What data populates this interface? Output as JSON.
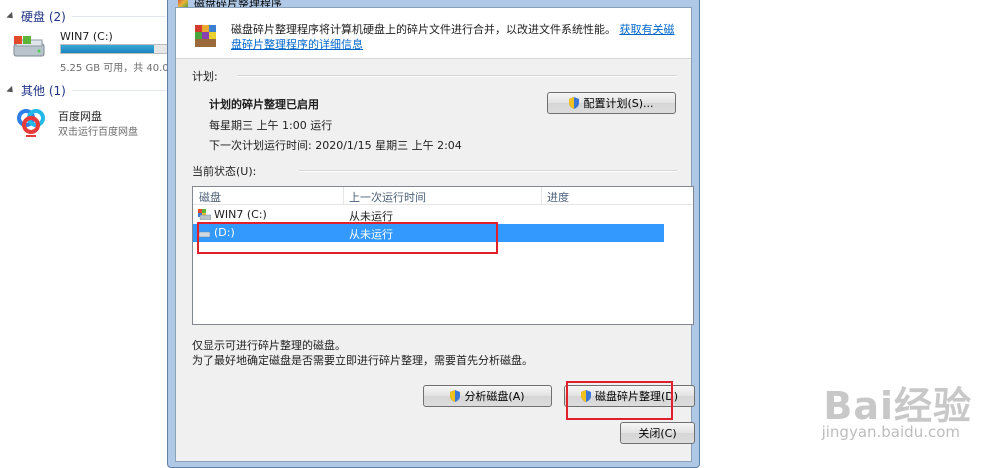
{
  "explorer": {
    "groups": [
      {
        "label": "硬盘 (2)"
      },
      {
        "label": "其他 (1)"
      }
    ],
    "drive_c": {
      "name": "WIN7 (C:)",
      "usage_text": "5.25 GB 可用，共 40.0",
      "used_fraction": 0.87
    },
    "baidu": {
      "name": "百度网盘",
      "subtitle": "双击运行百度网盘"
    }
  },
  "dialog": {
    "title": "磁盘碎片整理程序",
    "description": "磁盘碎片整理程序将计算机硬盘上的碎片文件进行合并，以改进文件系统性能。",
    "help_link": "获取有关磁盘碎片整理程序的详细信息",
    "schedule_section": "计划:",
    "schedule_status": "计划的碎片整理已启用",
    "schedule_time": "每星期三 上午 1:00 运行",
    "next_run": "下一次计划运行时间: 2020/1/15 星期三 上午 2:04",
    "configure_button": "配置计划(S)...",
    "current_status_section": "当前状态(U):",
    "columns": [
      "磁盘",
      "上一次运行时间",
      "进度"
    ],
    "disks": [
      {
        "name": "WIN7 (C:)",
        "last_run": "从未运行",
        "progress": "",
        "selected": false
      },
      {
        "name": "(D:)",
        "last_run": "从未运行",
        "progress": "",
        "selected": true
      }
    ],
    "note_line1": "仅显示可进行碎片整理的磁盘。",
    "note_line2": "为了最好地确定磁盘是否需要立即进行碎片整理，需要首先分析磁盘。",
    "analyze_button": "分析磁盘(A)",
    "defrag_button": "磁盘碎片整理(D)",
    "close_button": "关闭(C)"
  },
  "watermark": {
    "brand": "Bai经验",
    "url": "jingyan.baidu.com"
  },
  "colors": {
    "selection": "#3399ff",
    "highlight_box": "#e0212c",
    "link": "#0066cc"
  }
}
